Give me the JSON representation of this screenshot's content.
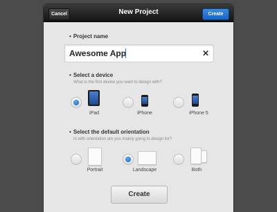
{
  "header": {
    "title": "New Project",
    "cancel_label": "Cancel",
    "create_label": "Create"
  },
  "project_name": {
    "label": "Project name",
    "value": "Awesome App"
  },
  "device": {
    "label": "Select a device",
    "subtitle": "What is the first device you want to design with?",
    "options": [
      {
        "label": "iPad",
        "selected": true,
        "icon": "ipad-icon"
      },
      {
        "label": "iPhone",
        "selected": false,
        "icon": "iphone-icon"
      },
      {
        "label": "iPhone 5",
        "selected": false,
        "icon": "iphone5-icon"
      }
    ]
  },
  "orientation": {
    "label": "Select the default orientation",
    "subtitle": "In with orientation are you mainly going to design for?",
    "options": [
      {
        "label": "Portrait",
        "selected": false,
        "icon": "portrait-icon"
      },
      {
        "label": "Landscape",
        "selected": true,
        "icon": "landscape-icon"
      },
      {
        "label": "Both",
        "selected": false,
        "icon": "both-orientations-icon"
      }
    ]
  },
  "footer": {
    "create_label": "Create"
  },
  "colors": {
    "accent": "#1a73d6",
    "background": "#4b4b4b",
    "panel": "#e6e6e6"
  }
}
